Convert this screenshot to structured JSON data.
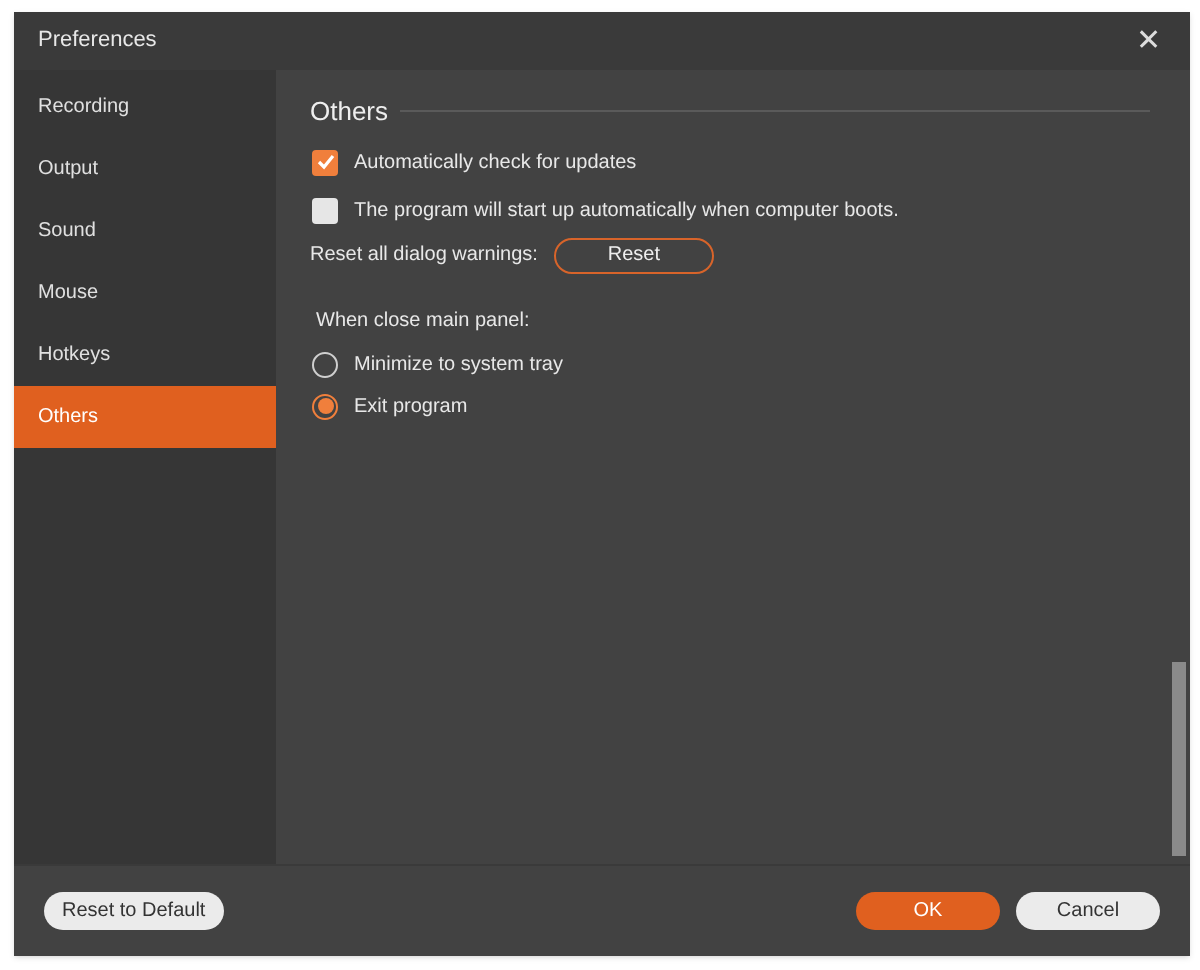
{
  "window": {
    "title": "Preferences",
    "close": "✕"
  },
  "sidebar": {
    "items": [
      {
        "label": "Recording",
        "selected": false
      },
      {
        "label": "Output",
        "selected": false
      },
      {
        "label": "Sound",
        "selected": false
      },
      {
        "label": "Mouse",
        "selected": false
      },
      {
        "label": "Hotkeys",
        "selected": false
      },
      {
        "label": "Others",
        "selected": true
      }
    ]
  },
  "section": {
    "title": "Others",
    "checkboxes": [
      {
        "label": "Automatically check for updates",
        "checked": true
      },
      {
        "label": "The program will start up automatically when computer boots.",
        "checked": false
      }
    ],
    "reset_label": "Reset all dialog warnings:",
    "reset_button": "Reset",
    "close_group": {
      "label": "When close main panel:",
      "options": [
        {
          "label": "Minimize to system tray",
          "selected": false
        },
        {
          "label": "Exit program",
          "selected": true
        }
      ]
    }
  },
  "footer": {
    "reset_default": "Reset to Default",
    "ok": "OK",
    "cancel": "Cancel"
  }
}
